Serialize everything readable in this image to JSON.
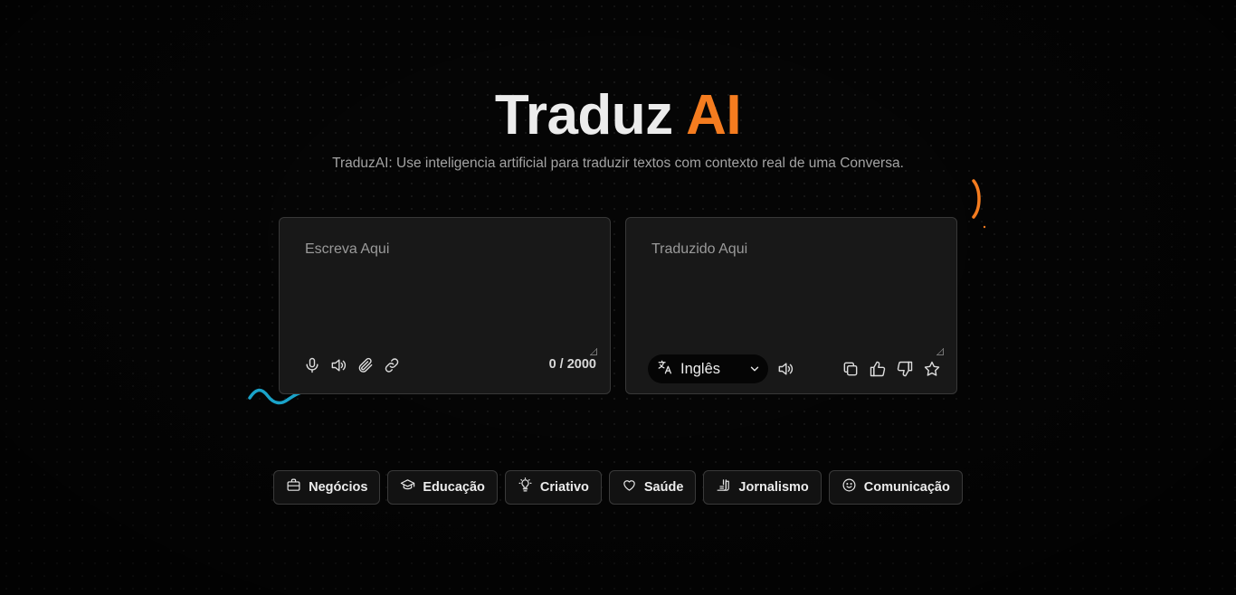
{
  "header": {
    "title_main": "Traduz",
    "title_accent": "AI",
    "subtitle": "TraduzAI: Use inteligencia artificial para traduzir textos com contexto real de uma Conversa."
  },
  "source_panel": {
    "placeholder": "Escreva Aqui",
    "value": "",
    "counter": "0 / 2000",
    "icons": [
      "microphone-icon",
      "speaker-icon",
      "paperclip-icon",
      "link-icon"
    ]
  },
  "target_panel": {
    "placeholder": "Traduzido Aqui",
    "value": "",
    "language": "Inglês",
    "icons": [
      "translate-icon",
      "speaker-icon",
      "copy-icon",
      "thumbs-up-icon",
      "thumbs-down-icon",
      "star-icon"
    ]
  },
  "categories": [
    {
      "label": "Negócios",
      "icon": "briefcase-icon"
    },
    {
      "label": "Educação",
      "icon": "graduation-cap-icon"
    },
    {
      "label": "Criativo",
      "icon": "lightbulb-icon"
    },
    {
      "label": "Saúde",
      "icon": "heart-icon"
    },
    {
      "label": "Jornalismo",
      "icon": "newspaper-icon"
    },
    {
      "label": "Comunicação",
      "icon": "smile-icon"
    }
  ],
  "colors": {
    "accent": "#f57c1f",
    "decor_blue": "#1aa3c9",
    "background": "#050505",
    "panel": "#181818"
  }
}
